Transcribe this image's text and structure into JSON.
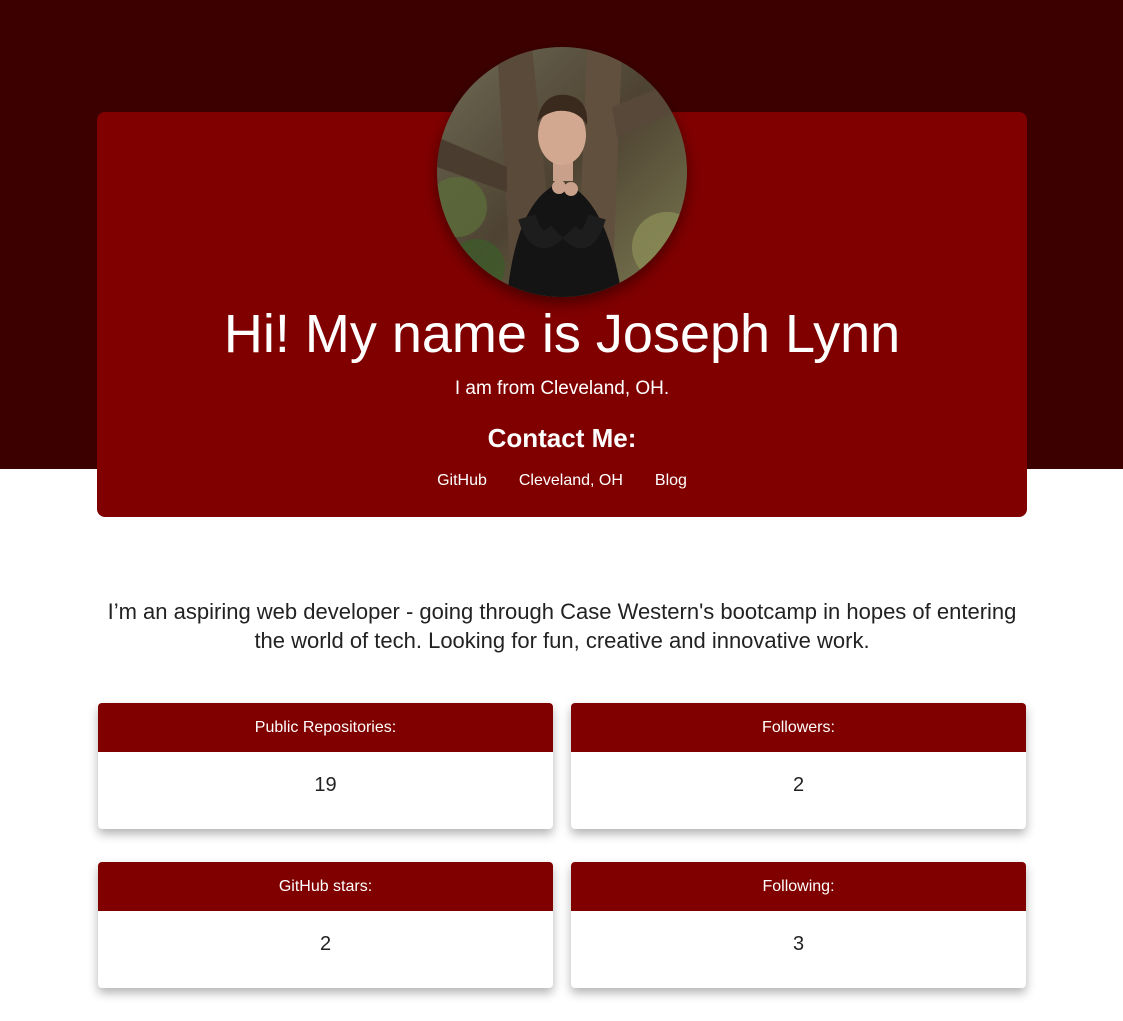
{
  "hero": {
    "title": "Hi! My name is Joseph Lynn",
    "subtitle": "I am from Cleveland, OH.",
    "contact_heading": "Contact Me:",
    "links": [
      {
        "label": "GitHub"
      },
      {
        "label": "Cleveland, OH"
      },
      {
        "label": "Blog"
      }
    ]
  },
  "bio": "I’m an aspiring web developer - going through Case Western's bootcamp in hopes of entering the world of tech. Looking for fun, creative and innovative work.",
  "stats": [
    {
      "label": "Public Repositories:",
      "value": "19"
    },
    {
      "label": "Followers:",
      "value": "2"
    },
    {
      "label": "GitHub stars:",
      "value": "2"
    },
    {
      "label": "Following:",
      "value": "3"
    }
  ],
  "colors": {
    "top_band": "#3d0000",
    "accent": "#800000",
    "text_light": "#ffffff",
    "text_dark": "#222222"
  },
  "icons": {
    "avatar": "profile-photo"
  }
}
